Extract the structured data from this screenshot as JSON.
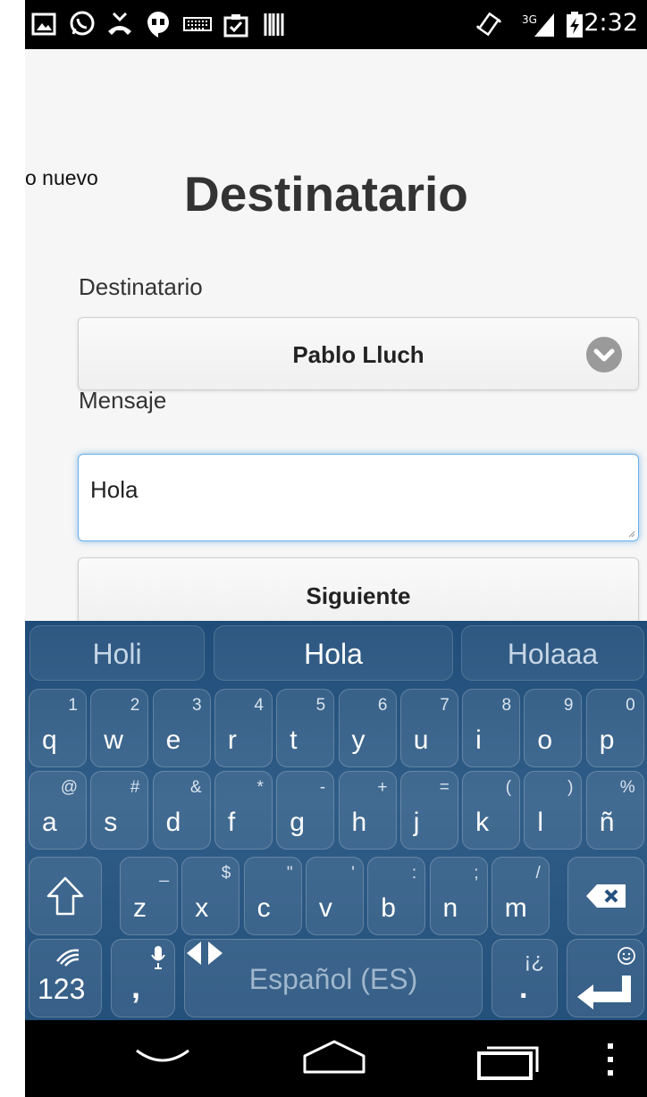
{
  "status_bar": {
    "time": "2:32",
    "network": "3G",
    "icons": [
      "image-icon",
      "whatsapp-icon",
      "missed-call-icon",
      "hangouts-icon",
      "keyboard-icon",
      "clipboard-icon",
      "barcode-icon",
      "vibrate-icon",
      "signal-icon",
      "battery-charging-icon"
    ]
  },
  "page": {
    "back_text": "o nuevo",
    "title": "Destinatario",
    "recipient_label": "Destinatario",
    "recipient_value": "Pablo Lluch",
    "message_label": "Mensaje",
    "message_value": "Hola",
    "next_label": "Siguiente"
  },
  "keyboard": {
    "suggestions": [
      "Holi",
      "Hola",
      "Holaaa"
    ],
    "row1": [
      [
        "q",
        "1"
      ],
      [
        "w",
        "2"
      ],
      [
        "e",
        "3"
      ],
      [
        "r",
        "4"
      ],
      [
        "t",
        "5"
      ],
      [
        "y",
        "6"
      ],
      [
        "u",
        "7"
      ],
      [
        "i",
        "8"
      ],
      [
        "o",
        "9"
      ],
      [
        "p",
        "0"
      ]
    ],
    "row2": [
      [
        "a",
        "@"
      ],
      [
        "s",
        "#"
      ],
      [
        "d",
        "&"
      ],
      [
        "f",
        "*"
      ],
      [
        "g",
        "-"
      ],
      [
        "h",
        "+"
      ],
      [
        "j",
        "="
      ],
      [
        "k",
        "("
      ],
      [
        "l",
        ")"
      ],
      [
        "ñ",
        "%"
      ]
    ],
    "row3": [
      [
        "z",
        "_"
      ],
      [
        "x",
        "$"
      ],
      [
        "c",
        "\""
      ],
      [
        "v",
        "'"
      ],
      [
        "b",
        ":"
      ],
      [
        "n",
        ";"
      ],
      [
        "m",
        "/"
      ]
    ],
    "numbers_label": "123",
    "comma_label": ",",
    "space_label": "Español (ES)",
    "period_label": ".",
    "period_alt": "¡¿"
  }
}
